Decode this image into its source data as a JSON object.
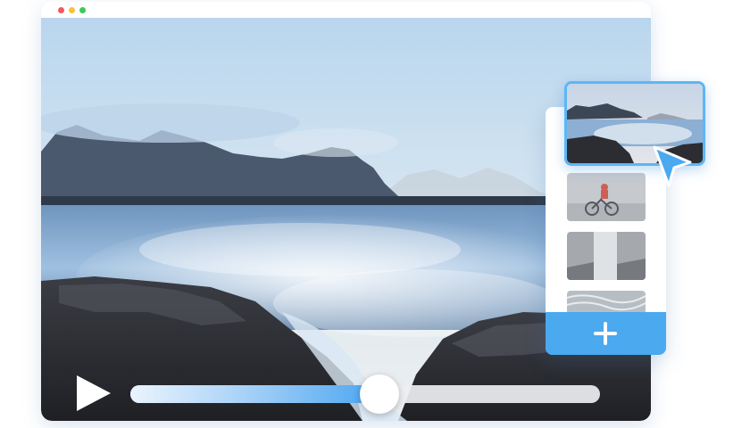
{
  "window": {
    "controls": [
      {
        "name": "close",
        "color": "#f25a5a"
      },
      {
        "name": "minimize",
        "color": "#f6c043"
      },
      {
        "name": "maximize",
        "color": "#3fc857"
      }
    ]
  },
  "player": {
    "video": "coastal-landscape-mountains-rocks",
    "play_icon": "play-icon",
    "progress_fraction": 0.53,
    "accent_color": "#4aa5f2"
  },
  "playlist": {
    "selected_thumbnail": "coastal-landscape-thumbnail",
    "thumbnails": [
      {
        "name": "cyclist-thumbnail"
      },
      {
        "name": "waterfall-thumbnail"
      },
      {
        "name": "water-texture-thumbnail"
      }
    ],
    "add_button_icon": "plus-icon",
    "add_button_color": "#4aa9ef"
  },
  "pointer": {
    "icon": "cursor-arrow-icon",
    "color": "#4aa9ef"
  }
}
